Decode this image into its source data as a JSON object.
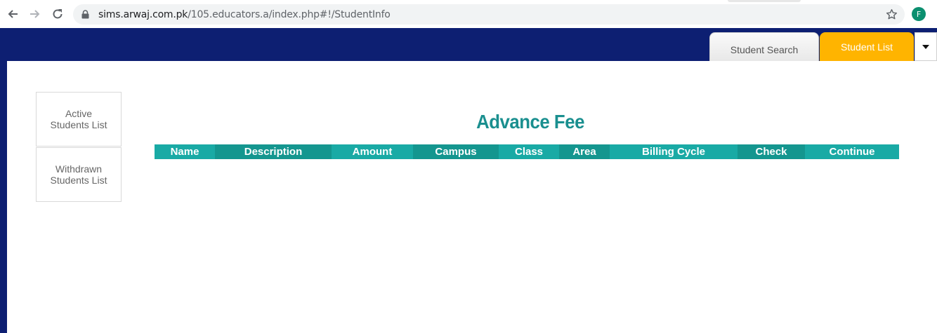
{
  "browser": {
    "url_host": "sims.arwaj.com.pk",
    "url_path": "/105.educators.a/index.php#!/StudentInfo",
    "profile_initial": "F"
  },
  "header": {
    "tabs": [
      {
        "label": "Student Search",
        "active": false
      },
      {
        "label": "Student List",
        "active": true
      }
    ],
    "colors": {
      "frame": "#0d1f72",
      "active_tab": "#ffb400"
    }
  },
  "sidebar": {
    "items": [
      {
        "label": "Active Students List"
      },
      {
        "label": "Withdrawn Students List"
      }
    ]
  },
  "main": {
    "title": "Advance Fee",
    "table": {
      "columns": [
        "Name",
        "Description",
        "Amount",
        "Campus",
        "Class",
        "Area",
        "Billing Cycle",
        "Check",
        "Continue"
      ],
      "rows": []
    },
    "colors": {
      "title": "#1a8f8f",
      "header_light": "#19aaa5",
      "header_dark": "#14968f"
    }
  }
}
